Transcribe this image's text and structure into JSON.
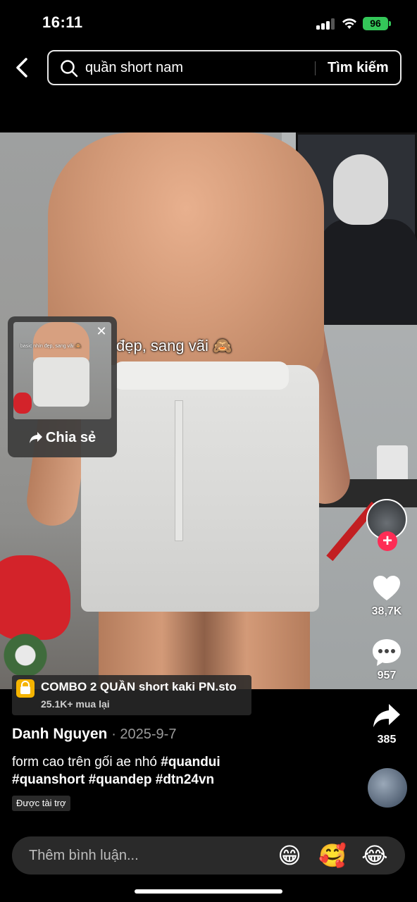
{
  "status_bar": {
    "time": "16:11",
    "battery": "96"
  },
  "search": {
    "query": "quần short nam",
    "submit_label": "Tìm kiếm"
  },
  "video": {
    "caption_overlay": "đẹp, sang vãi 🙈",
    "share_thumb_caption": "basic nhìn đẹp, sang vãi 🙈"
  },
  "share_popup": {
    "close_label": "✕",
    "share_label": "Chia sẻ"
  },
  "actions": {
    "follow_label": "+",
    "likes": "38,7K",
    "comments": "957",
    "shares": "385"
  },
  "product": {
    "title": "COMBO 2 QUẦN short kaki PN.sto",
    "subtitle": "25.1K+ mua lại"
  },
  "post": {
    "author": "Danh Nguyen",
    "date": "· 2025-9-7",
    "text": "form cao trên gối ae nhó",
    "hashtags": [
      "#quandui",
      "#quanshort",
      "#quandep",
      "#dtn24vn"
    ],
    "sponsored_label": "Được tài trợ"
  },
  "comment_bar": {
    "placeholder": "Thêm bình luận...",
    "emojis": [
      "😁",
      "🥰",
      "😂"
    ]
  },
  "colors": {
    "accent_red": "#fe2c55",
    "battery_green": "#34c759",
    "shop_yellow": "#f5b400"
  }
}
